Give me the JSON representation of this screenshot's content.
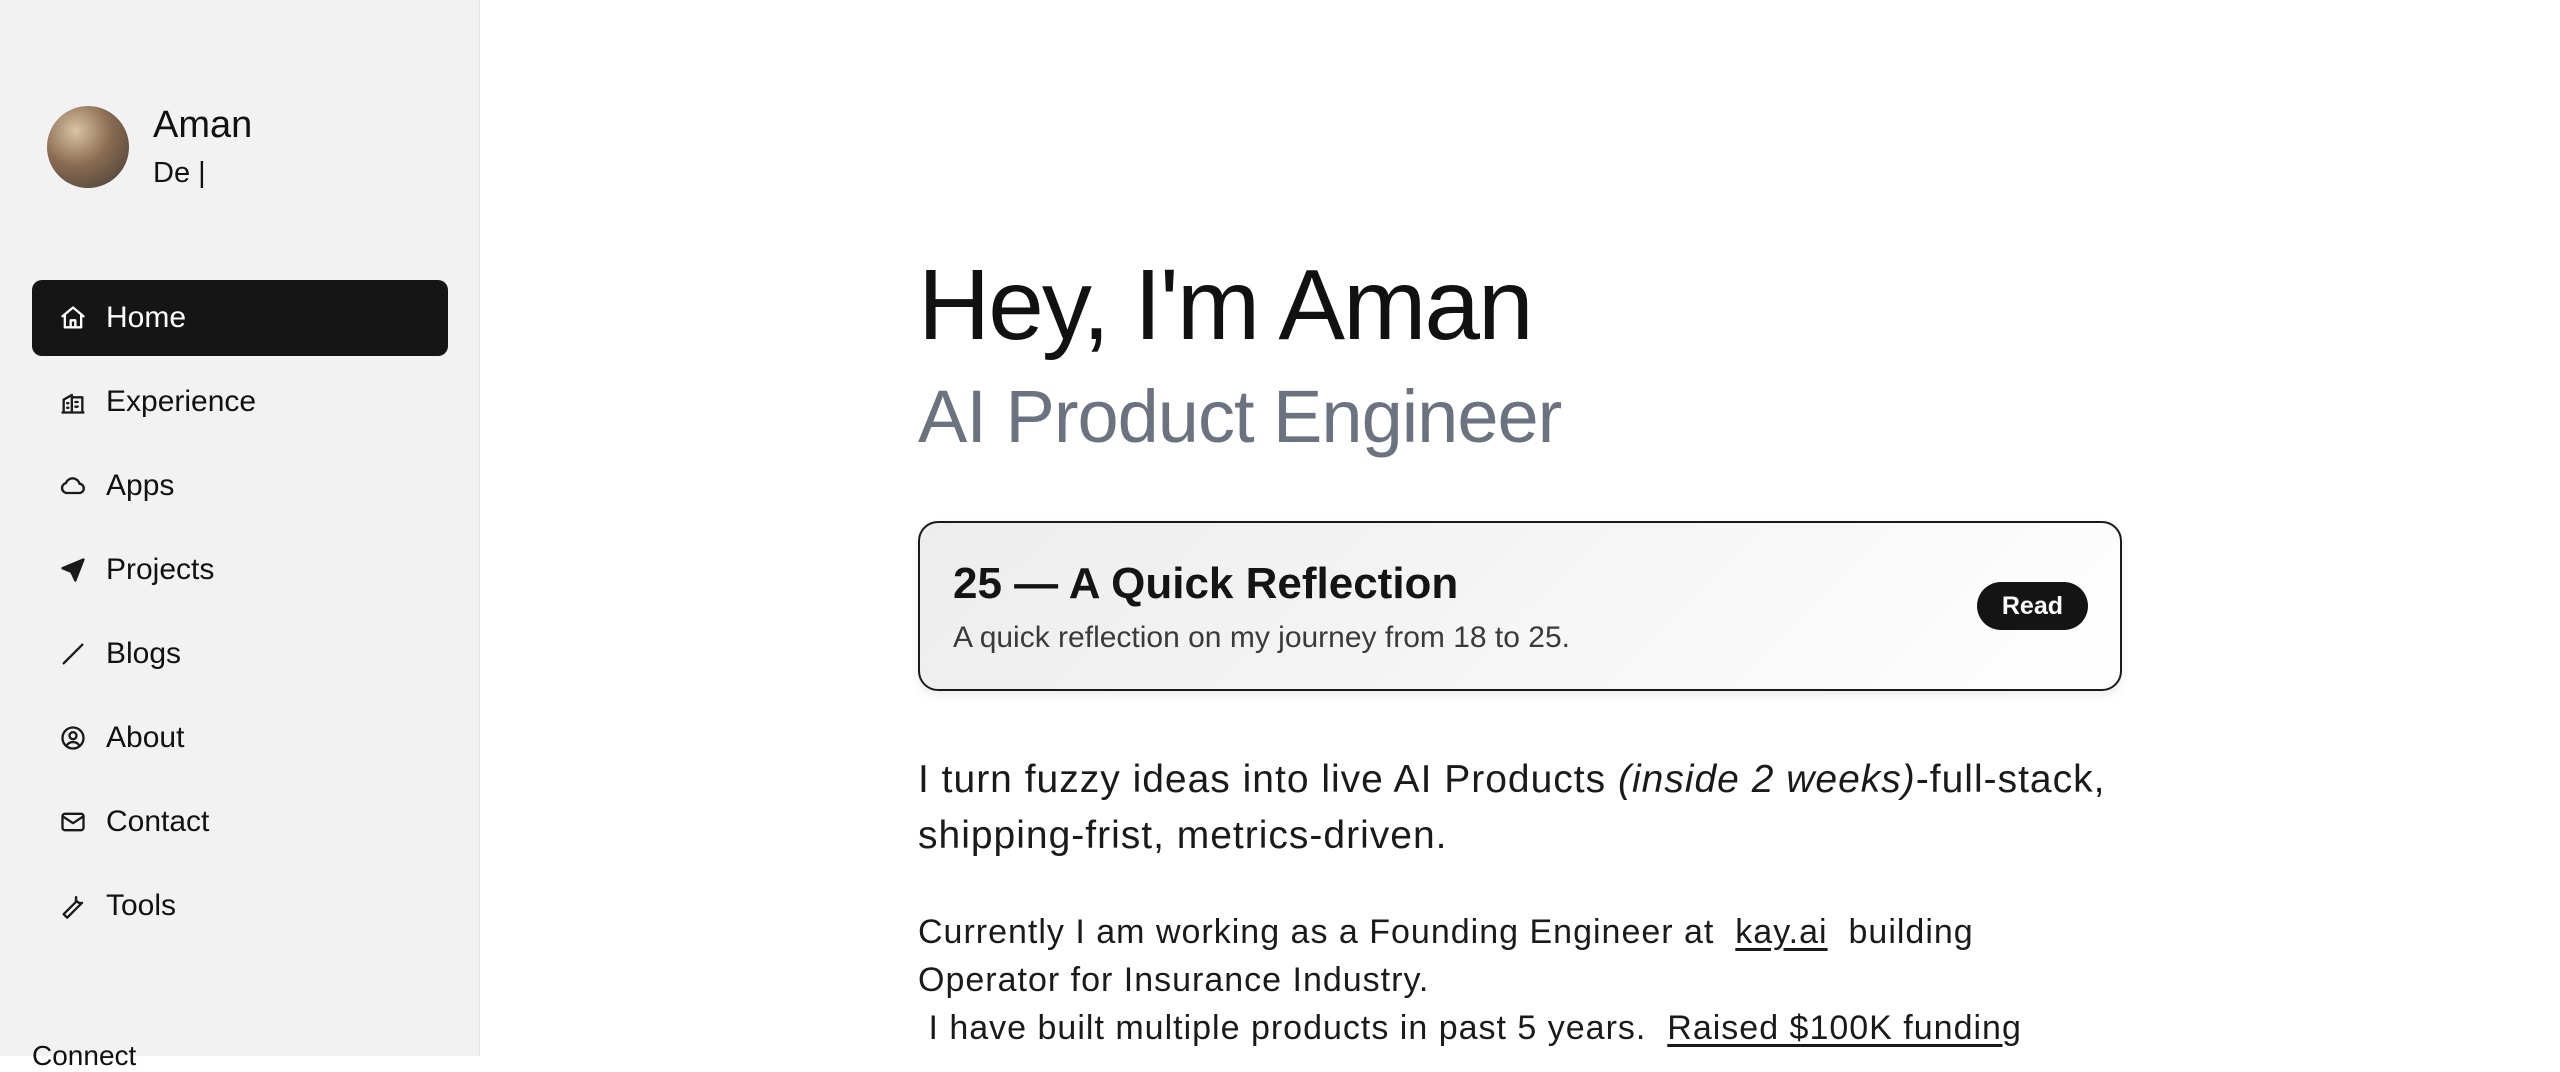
{
  "profile": {
    "name": "Aman",
    "subtitle": "De |"
  },
  "nav": [
    {
      "label": "Home",
      "icon": "home-icon",
      "active": true
    },
    {
      "label": "Experience",
      "icon": "building-icon"
    },
    {
      "label": "Apps",
      "icon": "cloud-icon"
    },
    {
      "label": "Projects",
      "icon": "navigation-arrow-icon"
    },
    {
      "label": "Blogs",
      "icon": "pen-line-icon"
    },
    {
      "label": "About",
      "icon": "user-circle-icon"
    },
    {
      "label": "Contact",
      "icon": "mail-icon"
    },
    {
      "label": "Tools",
      "icon": "wrench-icon"
    }
  ],
  "connect_label": "Connect",
  "hero": {
    "title": "Hey, I'm Aman",
    "subtitle": "AI Product Engineer"
  },
  "featured": {
    "title": "25 — A Quick Reflection",
    "description": "A quick reflection on my journey from 18 to 25.",
    "button": "Read"
  },
  "intro": {
    "part1": "I turn fuzzy ideas into live AI Products ",
    "emphasis": "(inside 2 weeks)",
    "part2": "-full-stack, shipping-frist, metrics-driven."
  },
  "bio": {
    "line1_prefix": "Currently I am working as a Founding Engineer at",
    "company_link": "kay.ai",
    "line1_suffix": "building Operator for Insurance Industry.",
    "line2_prefix": "I have built multiple products in past 5 years.",
    "funding_link": "Raised $100K funding"
  },
  "colors": {
    "sidebar_bg": "#f2f2f2",
    "active_bg": "#151515",
    "subtitle_gray": "#6b7280"
  }
}
